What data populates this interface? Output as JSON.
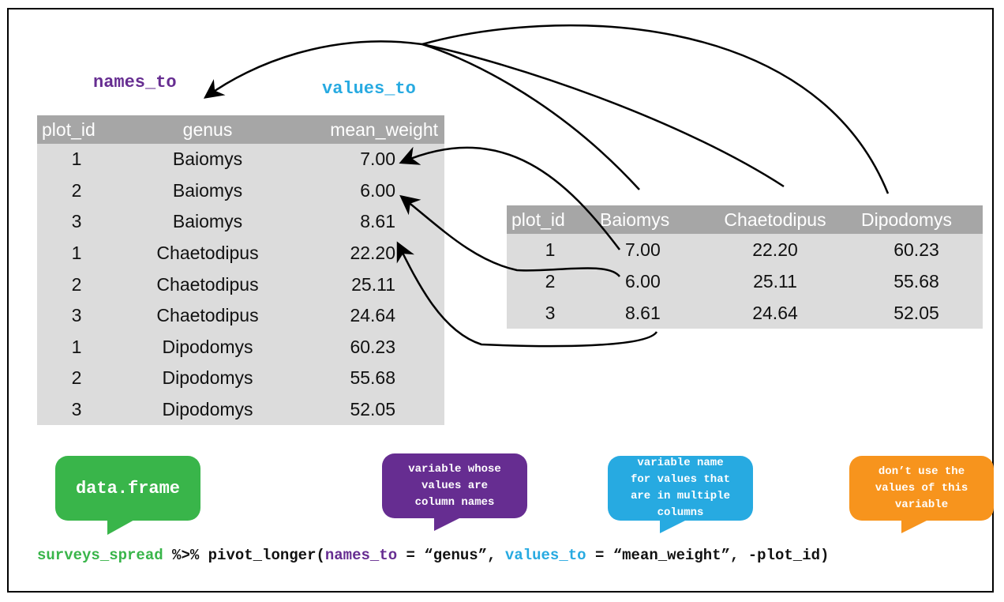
{
  "labels": {
    "names_to": "names_to",
    "values_to": "values_to"
  },
  "long_table": {
    "headers": [
      "plot_id",
      "genus",
      "mean_weight"
    ],
    "rows": [
      [
        "1",
        "Baiomys",
        "7.00"
      ],
      [
        "2",
        "Baiomys",
        "6.00"
      ],
      [
        "3",
        "Baiomys",
        "8.61"
      ],
      [
        "1",
        "Chaetodipus",
        "22.20"
      ],
      [
        "2",
        "Chaetodipus",
        "25.11"
      ],
      [
        "3",
        "Chaetodipus",
        "24.64"
      ],
      [
        "1",
        "Dipodomys",
        "60.23"
      ],
      [
        "2",
        "Dipodomys",
        "55.68"
      ],
      [
        "3",
        "Dipodomys",
        "52.05"
      ]
    ]
  },
  "wide_table": {
    "headers": [
      "plot_id",
      "Baiomys",
      "Chaetodipus",
      "Dipodomys"
    ],
    "rows": [
      [
        "1",
        "7.00",
        "22.20",
        "60.23"
      ],
      [
        "2",
        "6.00",
        "25.11",
        "55.68"
      ],
      [
        "3",
        "8.61",
        "24.64",
        "52.05"
      ]
    ]
  },
  "bubbles": {
    "data_frame": "data.frame",
    "names_to": [
      "variable whose",
      "values are",
      "column names"
    ],
    "values_to": [
      "variable name",
      "for values that",
      "are in multiple",
      "columns"
    ],
    "exclude": [
      "don’t use the",
      "values of this",
      "variable"
    ]
  },
  "code": {
    "df": "surveys_spread",
    "pipe": " %>% pivot_longer(",
    "names_arg": "names_to",
    "names_val": " = “genus”, ",
    "values_arg": "values_to",
    "values_val": " = “mean_weight”, -plot_id)"
  },
  "colors": {
    "data_frame": "#39b54a",
    "names_to": "#662d91",
    "values_to": "#27aae1",
    "exclude": "#f7941d",
    "table_header": "#a6a6a6",
    "table_body": "#dcdcdc"
  }
}
